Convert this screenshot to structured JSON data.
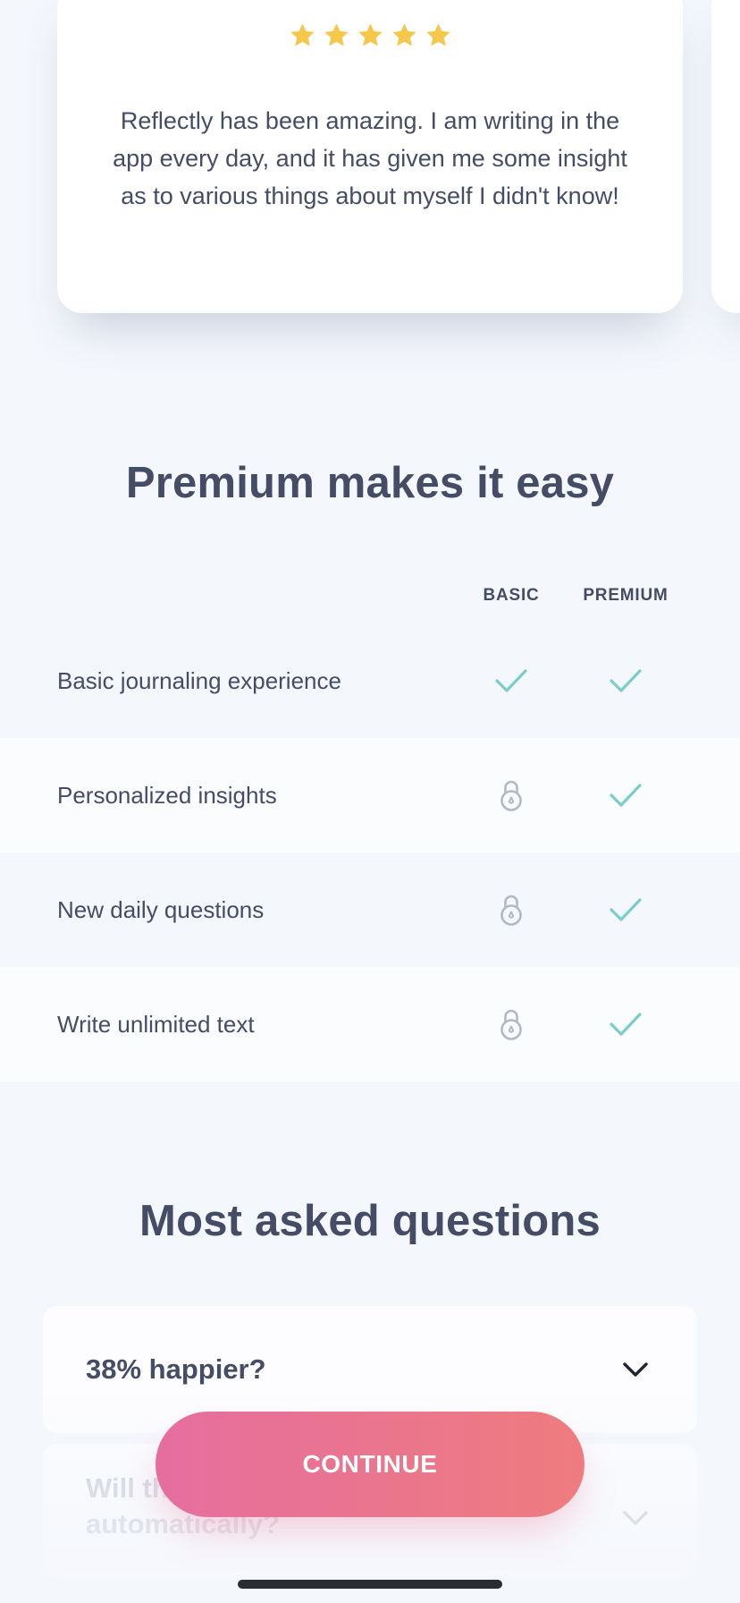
{
  "review": {
    "rating": 5,
    "max_rating": 5,
    "star_color": "#f5c84c",
    "text": "Reflectly has been amazing. I am writing in the app every day, and it has given me some insight as to various things about myself I didn't know!"
  },
  "comparison": {
    "title": "Premium makes it easy",
    "columns": {
      "basic": "BASIC",
      "premium": "PREMIUM"
    },
    "rows": [
      {
        "label": "Basic journaling experience",
        "basic": "check-icon",
        "premium": "check-icon"
      },
      {
        "label": "Personalized insights",
        "basic": "lock-icon",
        "premium": "check-icon"
      },
      {
        "label": "New daily questions",
        "basic": "lock-icon",
        "premium": "check-icon"
      },
      {
        "label": "Write unlimited text",
        "basic": "lock-icon",
        "premium": "check-icon"
      }
    ],
    "check_color": "#79cfc7",
    "lock_color": "#b3b8c6"
  },
  "faq": {
    "title": "Most asked questions",
    "items": [
      {
        "question": "38% happier?",
        "expanded": false
      },
      {
        "question_line1": "Will th",
        "question_line2": "automatically?",
        "expanded": false
      }
    ]
  },
  "cta": {
    "label": "CONTINUE",
    "gradient": [
      "#e66e9f",
      "#ee7c7e"
    ]
  }
}
